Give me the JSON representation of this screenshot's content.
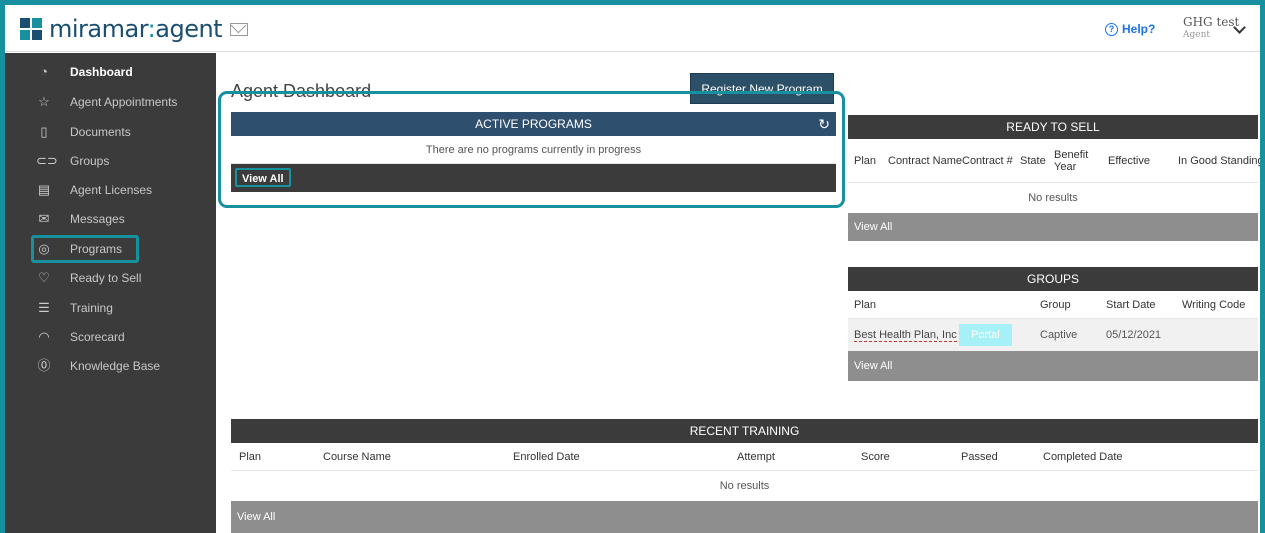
{
  "app": {
    "name_main": "miramar",
    "name_sep": ":",
    "name_sub": "agent"
  },
  "header": {
    "help_label": "Help?",
    "user_name": "GHG test",
    "user_role": "Agent"
  },
  "sidebar": {
    "items": [
      {
        "label": "Dashboard",
        "icon": "speedometer-icon"
      },
      {
        "label": "Agent Appointments",
        "icon": "star-icon"
      },
      {
        "label": "Documents",
        "icon": "document-icon"
      },
      {
        "label": "Groups",
        "icon": "groups-icon"
      },
      {
        "label": "Agent Licenses",
        "icon": "license-icon"
      },
      {
        "label": "Messages",
        "icon": "mail-icon"
      },
      {
        "label": "Programs",
        "icon": "eye-icon"
      },
      {
        "label": "Ready to Sell",
        "icon": "thumbs-up-icon"
      },
      {
        "label": "Training",
        "icon": "list-icon"
      },
      {
        "label": "Scorecard",
        "icon": "gauge-icon"
      },
      {
        "label": "Knowledge Base",
        "icon": "question-icon"
      }
    ]
  },
  "main": {
    "title": "Agent Dashboard",
    "register_button": "Register New Program",
    "active_programs": {
      "title": "ACTIVE PROGRAMS",
      "empty_text": "There are no programs currently in progress",
      "view_all": "View All"
    },
    "ready_to_sell": {
      "title": "READY TO SELL",
      "columns": [
        "Plan",
        "Contract Name",
        "Contract #",
        "State",
        "Benefit Year",
        "Effective",
        "In Good Standing"
      ],
      "empty_text": "No results",
      "view_all": "View All"
    },
    "groups": {
      "title": "GROUPS",
      "columns": [
        "Plan",
        "Group",
        "Start Date",
        "Writing Code"
      ],
      "rows": [
        {
          "plan": "Best Health Plan, Inc",
          "badge": "Portal",
          "group": "Captive",
          "start_date": "05/12/2021",
          "writing_code": ""
        }
      ],
      "view_all": "View All"
    },
    "recent_training": {
      "title": "RECENT TRAINING",
      "columns": [
        "Plan",
        "Course Name",
        "Enrolled Date",
        "Attempt",
        "Score",
        "Passed",
        "Completed Date"
      ],
      "empty_text": "No results",
      "view_all": "View All"
    }
  },
  "colors": {
    "accent": "#17919f",
    "brand": "#1b4f72",
    "panel_blue": "#2e4f6e",
    "sidebar": "#3b3b3b"
  }
}
